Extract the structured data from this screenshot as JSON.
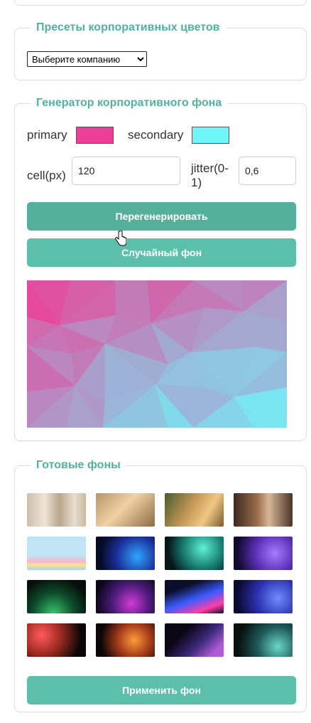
{
  "presets": {
    "legend": "Пресеты корпоративных цветов",
    "select_value": "Выберите компанию"
  },
  "generator": {
    "legend": "Генератор корпоративного фона",
    "primary_label": "primary",
    "primary_color": "#ec3f97",
    "secondary_label": "secondary",
    "secondary_color": "#6ef6fb",
    "cell_label": "cell(px)",
    "cell_value": "120",
    "jitter_label_line1": "jitter(0-",
    "jitter_label_line2": "1)",
    "jitter_value": "0,6",
    "regenerate_label": "Перегенерировать",
    "random_label": "Случайный фон"
  },
  "ready": {
    "legend": "Готовые фоны",
    "thumbnails": [
      "curtain-room",
      "sunlit-wall",
      "plant-window",
      "interior-room",
      "cartoon-ponies",
      "blue-dots-wave",
      "teal-glow",
      "purple-orbs",
      "green-glow",
      "purple-swirl",
      "pink-blue-wave",
      "blue-radial",
      "red-orange-dots",
      "orange-orbit",
      "purple-lines",
      "teal-circles"
    ],
    "apply_label": "Применить фон"
  },
  "icons": {
    "cursor": "hand-pointer-icon",
    "dropdown": "chevron-down-icon"
  }
}
